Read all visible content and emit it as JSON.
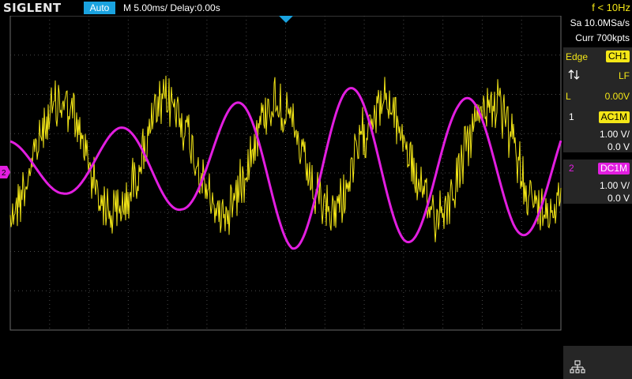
{
  "header": {
    "logo": "SIGLENT",
    "mode": "Auto",
    "timebase": "M 5.00ms/ Delay:0.00s",
    "frequency": "f < 10Hz"
  },
  "acquisition": {
    "sample_rate": "Sa 10.0MSa/s",
    "memory_depth": "Curr 700kpts"
  },
  "trigger": {
    "type": "Edge",
    "source": "CH1",
    "coupling": "LF",
    "level_label": "L",
    "level": "0.00V"
  },
  "channels": [
    {
      "number": "1",
      "coupling": "AC1M",
      "scale": "1.00 V/",
      "offset": "0.0 V",
      "color": "#f3e617"
    },
    {
      "number": "2",
      "coupling": "DC1M",
      "scale": "1.00 V/",
      "offset": "0.0 V",
      "color": "#e21ee0"
    }
  ],
  "colors": {
    "ch1": "#f3e617",
    "ch2": "#e21ee0",
    "trigger_marker": "#1aa3e0",
    "grid": "#5a5a5a"
  },
  "icons": {
    "trigger_slope": "slope-both-icon",
    "network": "network-icon"
  }
}
